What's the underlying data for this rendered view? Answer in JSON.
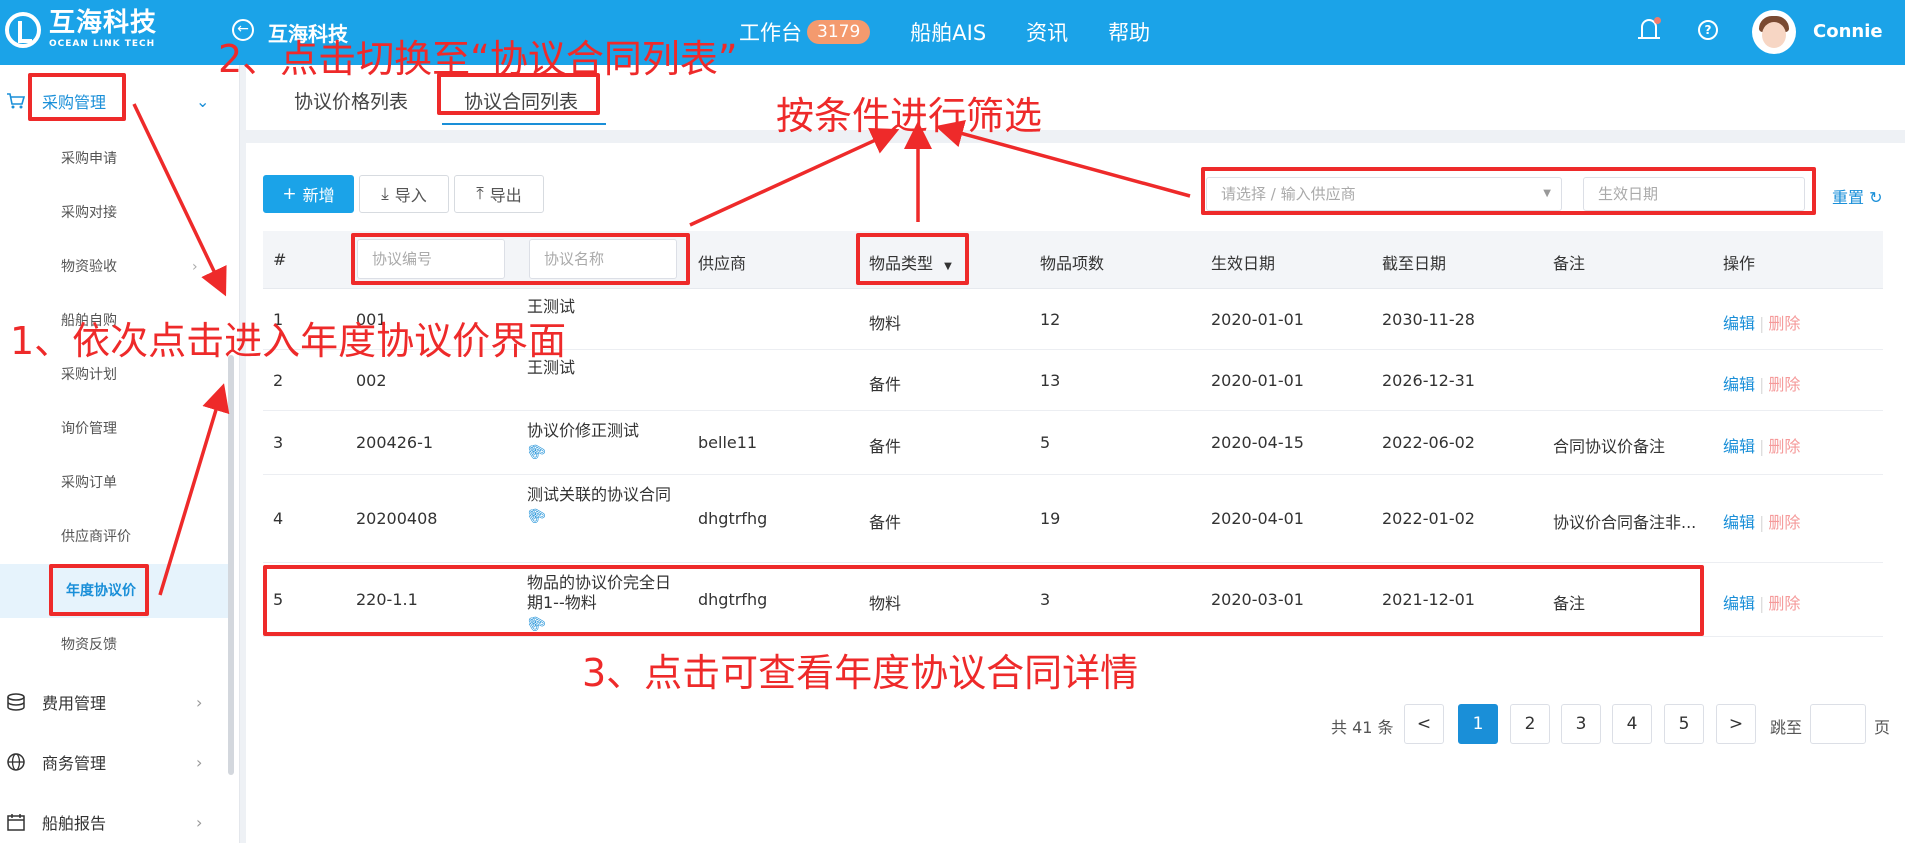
{
  "header": {
    "logo_main": "互海科技",
    "logo_sub": "OCEAN LINK TECH",
    "app_title": "互海科技",
    "nav": [
      {
        "label": "工作台",
        "badge": "3179"
      },
      {
        "label": "船舶AIS"
      },
      {
        "label": "资讯"
      },
      {
        "label": "帮助"
      }
    ],
    "user": "Connie",
    "icons": {
      "back": "back-arrow-icon",
      "bell": "bell-icon",
      "help": "help-icon"
    }
  },
  "sidebar": {
    "procurement": "采购管理",
    "items": [
      "采购申请",
      "采购对接",
      "物资验收",
      "船舶自购",
      "采购计划",
      "询价管理",
      "采购订单",
      "供应商评价",
      "年度协议价",
      "物资反馈"
    ],
    "active_item": "年度协议价",
    "other_groups": [
      "费用管理",
      "商务管理",
      "船舶报告"
    ]
  },
  "tabs": [
    "协议价格列表",
    "协议合同列表"
  ],
  "active_tab": "协议合同列表",
  "toolbar": {
    "add": "新增",
    "import": "导入",
    "export": "导出",
    "supplier_placeholder": "请选择 / 输入供应商",
    "date_placeholder": "生效日期",
    "reset": "重置"
  },
  "table": {
    "columns": {
      "idx": "#",
      "code_filter": "协议编号",
      "name_filter": "协议名称",
      "supplier": "供应商",
      "type": "物品类型",
      "count": "物品项数",
      "start": "生效日期",
      "end": "截至日期",
      "remark": "备注",
      "ops": "操作"
    },
    "rows": [
      {
        "idx": "1",
        "code": "001",
        "name": "王测试",
        "supplier": "",
        "type": "物料",
        "count": "12",
        "start": "2020-01-01",
        "end": "2030-11-28",
        "remark": "",
        "attach": false
      },
      {
        "idx": "2",
        "code": "002",
        "name": "王测试",
        "supplier": "",
        "type": "备件",
        "count": "13",
        "start": "2020-01-01",
        "end": "2026-12-31",
        "remark": "",
        "attach": false
      },
      {
        "idx": "3",
        "code": "200426-1",
        "name": "协议价修正测试",
        "supplier": "belle11",
        "type": "备件",
        "count": "5",
        "start": "2020-04-15",
        "end": "2022-06-02",
        "remark": "合同协议价备注",
        "attach": true
      },
      {
        "idx": "4",
        "code": "20200408",
        "name": "测试关联的协议合同",
        "supplier": "dhgtrfhg",
        "type": "备件",
        "count": "19",
        "start": "2020-04-01",
        "end": "2022-01-02",
        "remark": "协议价合同备注非...",
        "attach": true
      },
      {
        "idx": "5",
        "code": "220-1.1",
        "name": "物品的协议价完全日期1--物料",
        "supplier": "dhgtrfhg",
        "type": "物料",
        "count": "3",
        "start": "2020-03-01",
        "end": "2021-12-01",
        "remark": "备注",
        "attach": true
      }
    ],
    "edit": "编辑",
    "delete": "删除"
  },
  "pagination": {
    "total": "共 41 条",
    "prev": "<",
    "pages": [
      "1",
      "2",
      "3",
      "4",
      "5"
    ],
    "current": "1",
    "next": ">",
    "jump": "跳至",
    "page_unit": "页"
  },
  "annotations": {
    "step1": "1、依次点击进入年度协议价界面",
    "step2": "2、点击切换至“协议合同列表”",
    "step3": "3、点击可查看年度协议合同详情",
    "filter": "按条件进行筛选",
    "color": "#ee2a2a"
  }
}
